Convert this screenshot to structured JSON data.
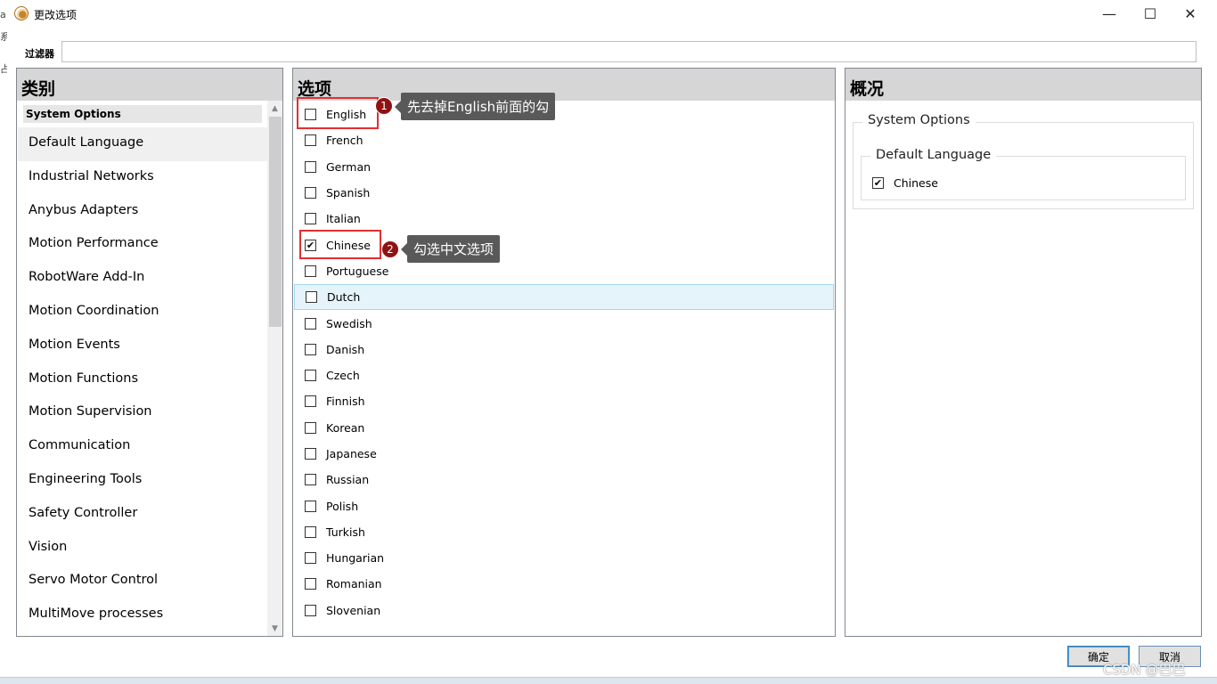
{
  "window": {
    "title": "更改选项",
    "minimize_glyph": "—",
    "maximize_glyph": "☐",
    "close_glyph": "✕",
    "edge_glyphs": [
      "a",
      "系",
      "占"
    ]
  },
  "filter": {
    "label": "过滤器",
    "value": ""
  },
  "categories": {
    "header": "类别",
    "group_label": "System Options",
    "items": [
      {
        "label": "Default Language",
        "selected": true
      },
      {
        "label": "Industrial Networks"
      },
      {
        "label": "Anybus Adapters"
      },
      {
        "label": "Motion Performance"
      },
      {
        "label": "RobotWare Add-In"
      },
      {
        "label": "Motion Coordination"
      },
      {
        "label": "Motion Events"
      },
      {
        "label": "Motion Functions"
      },
      {
        "label": "Motion Supervision"
      },
      {
        "label": "Communication"
      },
      {
        "label": "Engineering Tools"
      },
      {
        "label": "Safety Controller"
      },
      {
        "label": "Vision"
      },
      {
        "label": "Servo Motor Control"
      },
      {
        "label": "MultiMove processes"
      }
    ]
  },
  "options": {
    "header": "选项",
    "items": [
      {
        "label": "English",
        "checked": false
      },
      {
        "label": "French",
        "checked": false
      },
      {
        "label": "German",
        "checked": false
      },
      {
        "label": "Spanish",
        "checked": false
      },
      {
        "label": "Italian",
        "checked": false
      },
      {
        "label": "Chinese",
        "checked": true
      },
      {
        "label": "Portuguese",
        "checked": false
      },
      {
        "label": "Dutch",
        "checked": false,
        "highlighted": true
      },
      {
        "label": "Swedish",
        "checked": false
      },
      {
        "label": "Danish",
        "checked": false
      },
      {
        "label": "Czech",
        "checked": false
      },
      {
        "label": "Finnish",
        "checked": false
      },
      {
        "label": "Korean",
        "checked": false
      },
      {
        "label": "Japanese",
        "checked": false
      },
      {
        "label": "Russian",
        "checked": false
      },
      {
        "label": "Polish",
        "checked": false
      },
      {
        "label": "Turkish",
        "checked": false
      },
      {
        "label": "Hungarian",
        "checked": false
      },
      {
        "label": "Romanian",
        "checked": false
      },
      {
        "label": "Slovenian",
        "checked": false
      }
    ]
  },
  "annotations": [
    {
      "number": "1",
      "text": "先去掉English前面的勾"
    },
    {
      "number": "2",
      "text": "勾选中文选项"
    }
  ],
  "summary": {
    "header": "概况",
    "group_label": "System Options",
    "subgroup_label": "Default Language",
    "selected_option": "Chinese",
    "check_glyph": "✔"
  },
  "buttons": {
    "ok": "确定",
    "cancel": "取消"
  },
  "watermark": "CSDN @巴巴",
  "colors": {
    "header_bg": "#d6d6d6",
    "highlight_row": "#e5f3fb",
    "annotation_box": "#e03030",
    "callout_badge": "#8e1212",
    "callout_bg": "#595959"
  }
}
